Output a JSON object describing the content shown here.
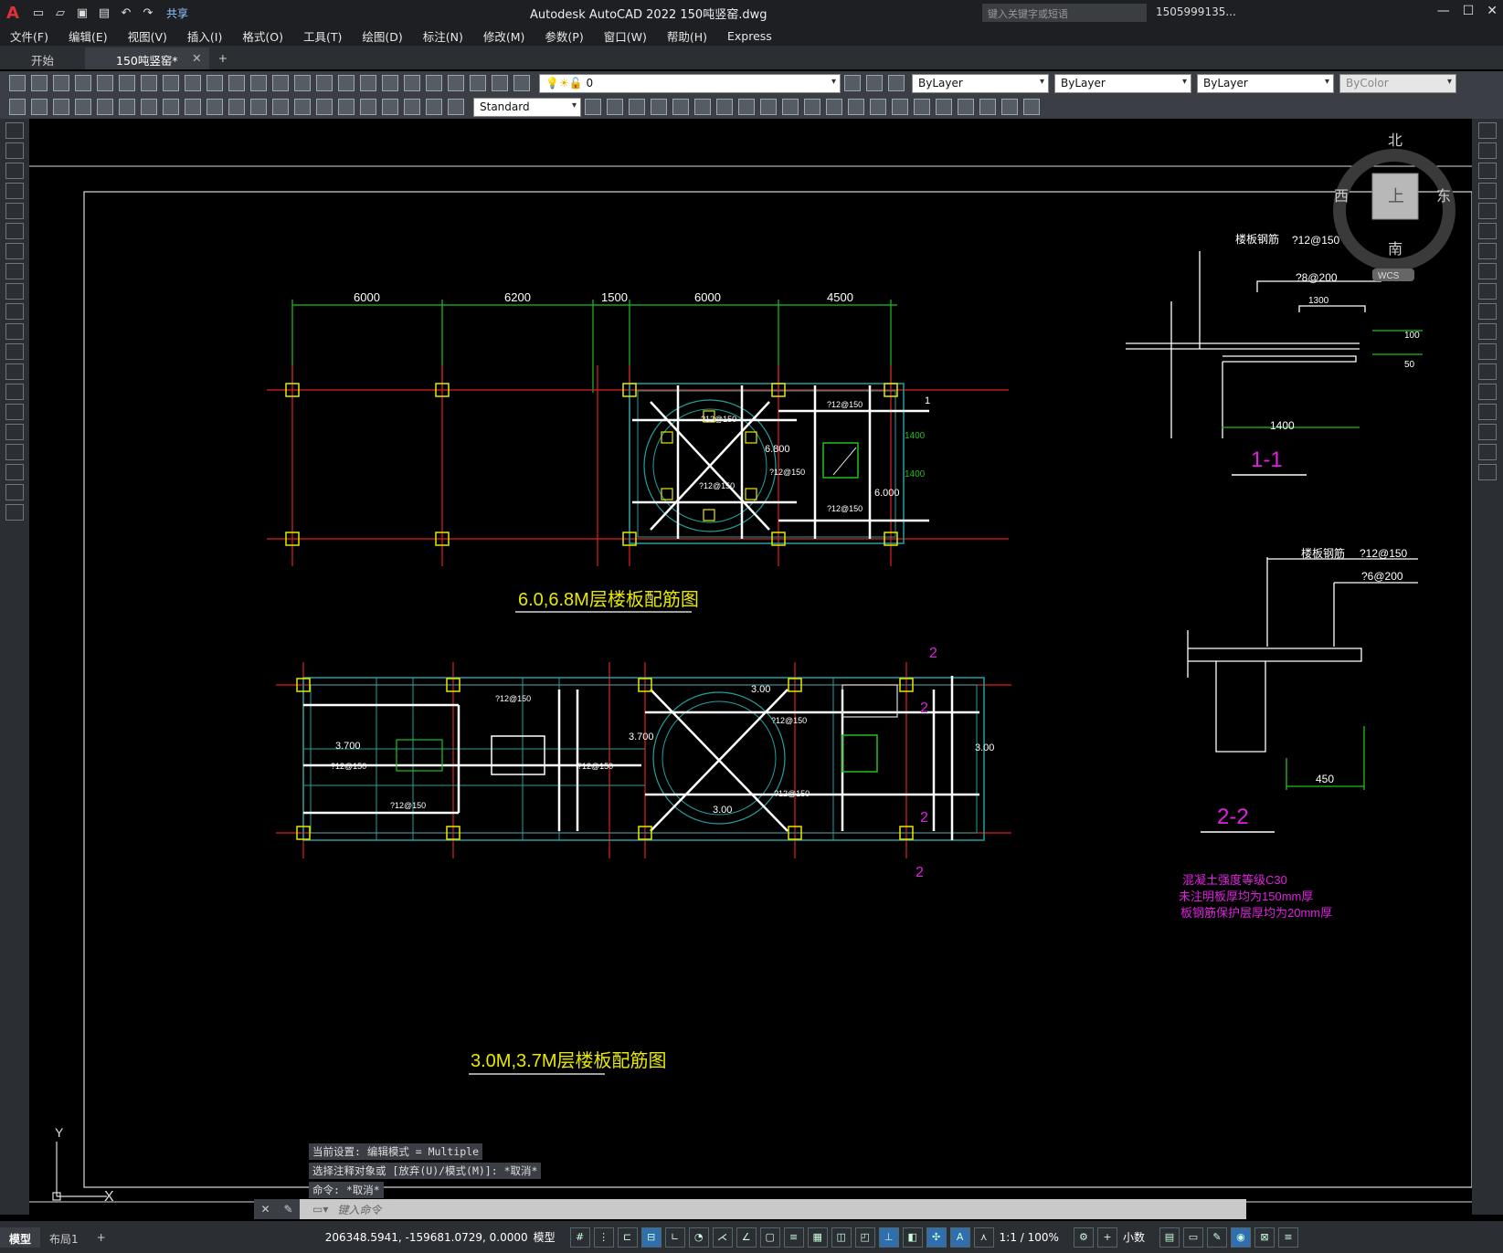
{
  "window": {
    "title": "Autodesk AutoCAD 2022    150吨竖窑.dwg",
    "share_label": "共享",
    "search_placeholder": "键入关键字或短语",
    "user": "1505999135..."
  },
  "menu": [
    "文件(F)",
    "编辑(E)",
    "视图(V)",
    "插入(I)",
    "格式(O)",
    "工具(T)",
    "绘图(D)",
    "标注(N)",
    "修改(M)",
    "参数(P)",
    "窗口(W)",
    "帮助(H)",
    "Express"
  ],
  "tabs": {
    "start": "开始",
    "file": "150吨竖窑*",
    "add": "+"
  },
  "properties": {
    "layer": "0",
    "color": "ByLayer",
    "linetype": "ByLayer",
    "lineweight": "ByLayer",
    "plotstyle": "ByColor",
    "textstyle": "Standard"
  },
  "viewcube": {
    "north": "北",
    "south": "南",
    "east": "东",
    "west": "西",
    "top": "上",
    "wcs": "WCS"
  },
  "drawing": {
    "dims_top": [
      "6000",
      "6200",
      "1500",
      "6000",
      "4500"
    ],
    "plan1_title": "6.0,6.8M层楼板配筋图",
    "plan2_title": "3.0M,3.7M层楼板配筋图",
    "plan1_labels": {
      "r1": "?12@150",
      "elev1": "6.800",
      "elev2": "6.000",
      "d1": "1400",
      "d2": "1400",
      "sec": "1"
    },
    "plan2_labels": {
      "r1": "?12@150",
      "elev1": "3.700",
      "elev2": "3.700",
      "elev3": "3.00",
      "elev4": "3.00",
      "elev5": "3.00",
      "sec": "2"
    },
    "sec11": {
      "title": "1-1",
      "label": "楼板钢筋",
      "r1": "?12@150",
      "r2": "?8@200",
      "d1": "1300",
      "d2": "1400",
      "d3": "100",
      "d4": "50"
    },
    "sec22": {
      "title": "2-2",
      "label": "楼板钢筋",
      "r1": "?12@150",
      "r2": "?6@200",
      "d1": "450"
    },
    "notes": [
      "混凝土强度等级C30",
      "未注明板厚均为150mm厚",
      "板钢筋保护层厚均为20mm厚"
    ],
    "ucs": {
      "x": "X",
      "y": "Y"
    }
  },
  "command": {
    "lines": [
      "当前设置: 编辑模式 = Multiple",
      "选择注释对象或 [放弃(U)/模式(M)]: *取消*",
      "命令: *取消*"
    ],
    "placeholder": "键入命令"
  },
  "status": {
    "tab_model": "模型",
    "tab_layout": "布局1",
    "coords": "206348.5941, -159681.0729, 0.0000",
    "space": "模型",
    "scale": "1:1 / 100%",
    "units": "小数"
  }
}
